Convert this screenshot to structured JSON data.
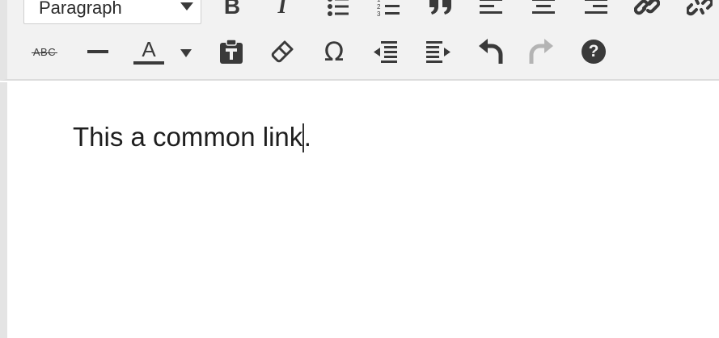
{
  "toolbar": {
    "format_select": {
      "value": "Paragraph"
    },
    "row1": [
      {
        "icon": "bold-icon",
        "label": "B"
      },
      {
        "icon": "italic-icon",
        "label": "I"
      },
      {
        "icon": "bullet-list-icon"
      },
      {
        "icon": "numbered-list-icon",
        "numbers": [
          "1",
          "2",
          "3"
        ]
      },
      {
        "icon": "blockquote-icon"
      },
      {
        "icon": "align-left-icon"
      },
      {
        "icon": "align-center-icon"
      },
      {
        "icon": "align-right-icon"
      },
      {
        "icon": "insert-link-icon"
      },
      {
        "icon": "remove-link-icon"
      }
    ],
    "row2": [
      {
        "icon": "strikethrough-icon",
        "label": "ABC"
      },
      {
        "icon": "horizontal-line-icon"
      },
      {
        "icon": "text-color-icon",
        "label": "A"
      },
      {
        "icon": "paste-as-text-icon"
      },
      {
        "icon": "clear-formatting-icon"
      },
      {
        "icon": "special-character-icon",
        "label": "Ω"
      },
      {
        "icon": "decrease-indent-icon"
      },
      {
        "icon": "increase-indent-icon"
      },
      {
        "icon": "undo-icon"
      },
      {
        "icon": "redo-icon",
        "state": "disabled"
      },
      {
        "icon": "help-icon",
        "label": "?"
      }
    ]
  },
  "content": {
    "text_before_caret": "This a common link",
    "text_after_caret": "."
  },
  "colors": {
    "toolbar_bg": "#f2f2f2",
    "icon": "#3a3a3a",
    "icon_disabled": "#b4b4b4",
    "text": "#1e1e1e"
  }
}
